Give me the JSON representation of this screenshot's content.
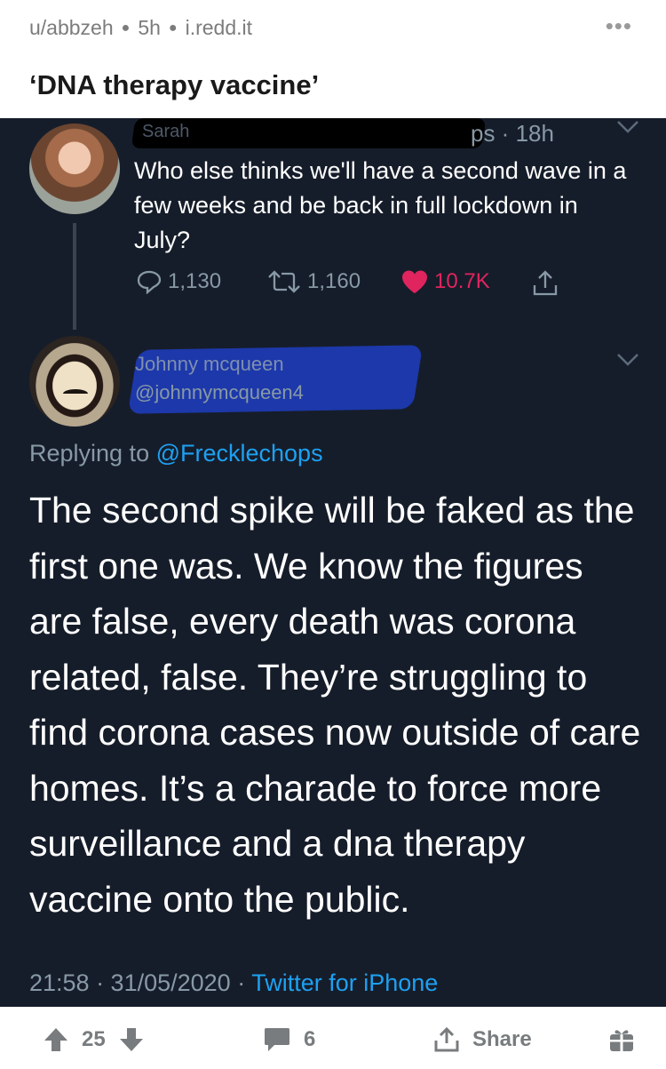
{
  "post": {
    "user": "u/abbzeh",
    "age": "5h",
    "source": "i.redd.it",
    "more_label": "•••",
    "title": "‘DNA therapy vaccine’"
  },
  "tweet1": {
    "name": "Sarah",
    "time": "ps · 18h",
    "text": "Who else thinks we'll have a second wave in a few weeks and be back in full lockdown in July?",
    "replies": "1,130",
    "retweets": "1,160",
    "likes": "10.7K"
  },
  "tweet2": {
    "name": "Johnny mcqueen",
    "handle": "@johnnymcqueen4",
    "replying_prefix": "Replying to ",
    "replying_to": "@Frecklechops",
    "text": "The second spike will be faked as the first one was. We know the figures are false, every death was corona related, false. They’re struggling to find corona cases now outside of care homes. It’s a charade to force more surveillance and a dna therapy vaccine onto the public.",
    "timestamp": "21:58 · 31/05/2020 · ",
    "client": "Twitter for iPhone"
  },
  "actions": {
    "votes": "25",
    "comments": "6",
    "share_label": "Share"
  },
  "colors": {
    "tweet_bg": "#161d2a",
    "link": "#1da1f2",
    "like": "#e0245e",
    "muted": "#8899a6"
  }
}
